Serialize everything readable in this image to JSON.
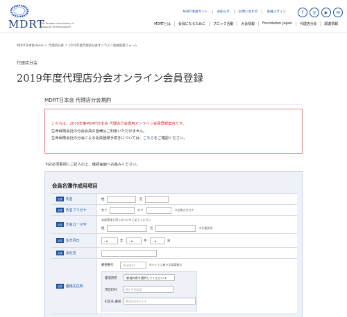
{
  "header": {
    "logo_text": "MDRT",
    "tagline": "The Premier Association of Financial Professionals®",
    "utility_links": [
      "MDRT本部サイト",
      "お知らせ",
      "お問い合わせ",
      "会員ログイン"
    ],
    "social_icons": [
      "facebook-icon",
      "instagram-icon",
      "youtube-icon",
      "mail-icon"
    ],
    "social_glyphs": [
      "f",
      "◎",
      "▶",
      "✉"
    ],
    "nav": [
      "MDRTとは",
      "会員になるために",
      "ブロック活動",
      "大会情報",
      "Foundation-Japan",
      "代理店分会",
      "関連情報"
    ]
  },
  "breadcrumb": "MDRT日本会Home ＞ 代理店分会 ＞ 2019年度代理店分会オンライン会員登録フォーム",
  "eyebrow": "代理店分会",
  "page_title": "2019年度代理店分会オンライン会員登録",
  "section_title": "MDRT日本会 代理店分会規約",
  "notice": {
    "line1": "こちらは、2019年度MDRT日本会 代理店分会専用オンライン会員登録案内です。",
    "line2": "生命保険会社の分会会員の皆様はご利用いただけません。",
    "line3_prefix": "生命保険会社の分会による会員登録手続きについては、",
    "line3_link": "こちら",
    "line3_suffix": "をご確認ください。"
  },
  "instruction": "下記必須事項にご記入の上、確認画面へお進みください。",
  "form": {
    "title": "会員名簿作成用項目",
    "required": "必須",
    "name": {
      "label": "氏名",
      "sei": "姓",
      "mei": "名"
    },
    "furigana": {
      "label": "氏名フリガナ",
      "sei": "セイ",
      "mei": "メイ",
      "hint": "※全角カタカナ"
    },
    "romaji": {
      "label": "氏名ローマ字",
      "note": "本部登録と同じスペルをご記入ください",
      "sei": "姓",
      "mei": "名",
      "hint": "※半角英字"
    },
    "birthday": {
      "label": "生年月日",
      "year_value": "-",
      "year": "年",
      "month_value": "-",
      "month": "月",
      "day_value": "-",
      "day": "日"
    },
    "company": {
      "label": "会社名"
    },
    "contact": {
      "label": "連絡先住所",
      "zip_label": "郵便番号",
      "zip_placeholder": "1030047",
      "zip_hint": "※ハイフン無き半角英数字",
      "pref_label": "都道府県",
      "pref_value": "都道府県を選択してください",
      "city_label": "市区町村",
      "city_placeholder": "例) 千代田区",
      "street_label": "町区名,番地",
      "street_placeholder": "例)丸の内1-2-3"
    }
  }
}
